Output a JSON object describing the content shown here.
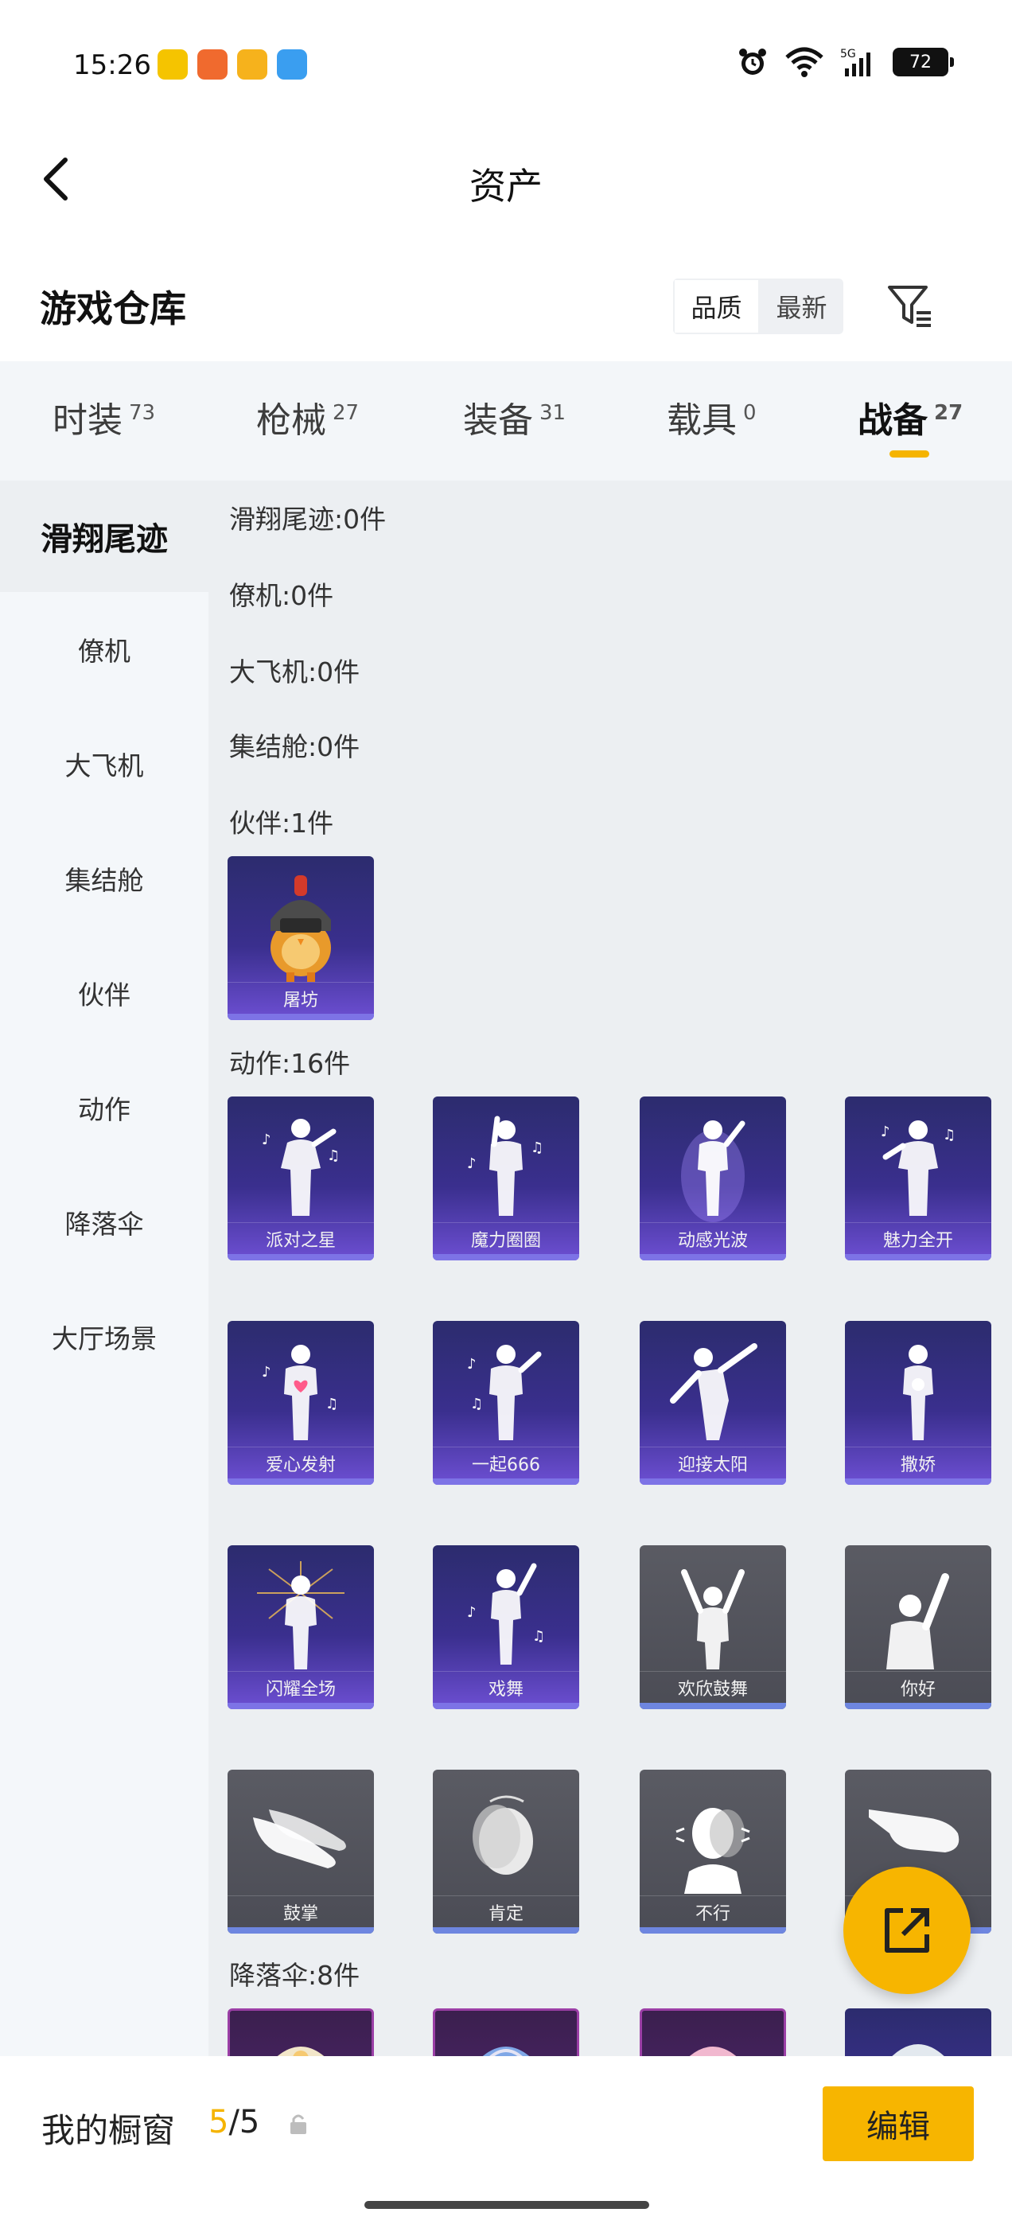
{
  "status_bar": {
    "time": "15:26",
    "battery": "72",
    "network": "5G"
  },
  "nav": {
    "title": "资产"
  },
  "section": {
    "title": "游戏仓库",
    "sort_options": [
      "品质",
      "最新"
    ]
  },
  "tabs": [
    {
      "label": "时装",
      "count": "73"
    },
    {
      "label": "枪械",
      "count": "27"
    },
    {
      "label": "装备",
      "count": "31"
    },
    {
      "label": "载具",
      "count": "0"
    },
    {
      "label": "战备",
      "count": "27"
    }
  ],
  "sidebar": {
    "items": [
      "滑翔尾迹",
      "僚机",
      "大飞机",
      "集结舱",
      "伙伴",
      "动作",
      "降落伞",
      "大厅场景"
    ]
  },
  "content": {
    "groups": [
      "滑翔尾迹:0件",
      "僚机:0件",
      "大飞机:0件",
      "集结舱:0件",
      "伙伴:1件",
      "动作:16件",
      "降落伞:8件"
    ],
    "partner_items": [
      "屠坊"
    ],
    "action_items": [
      "派对之星",
      "魔力圈圈",
      "动感光波",
      "魅力全开",
      "爱心发射",
      "一起666",
      "迎接太阳",
      "撒娇",
      "闪耀全场",
      "戏舞",
      "欢欣鼓舞",
      "你好",
      "鼓掌",
      "肯定",
      "不行",
      ""
    ]
  },
  "bottom": {
    "showcase_label": "我的橱窗",
    "count_current": "5",
    "count_total": "/5",
    "edit_label": "编辑"
  },
  "colors": {
    "accent": "#f7b500",
    "card_purple": "#3a2f8e",
    "card_gray": "#4b4c55"
  }
}
